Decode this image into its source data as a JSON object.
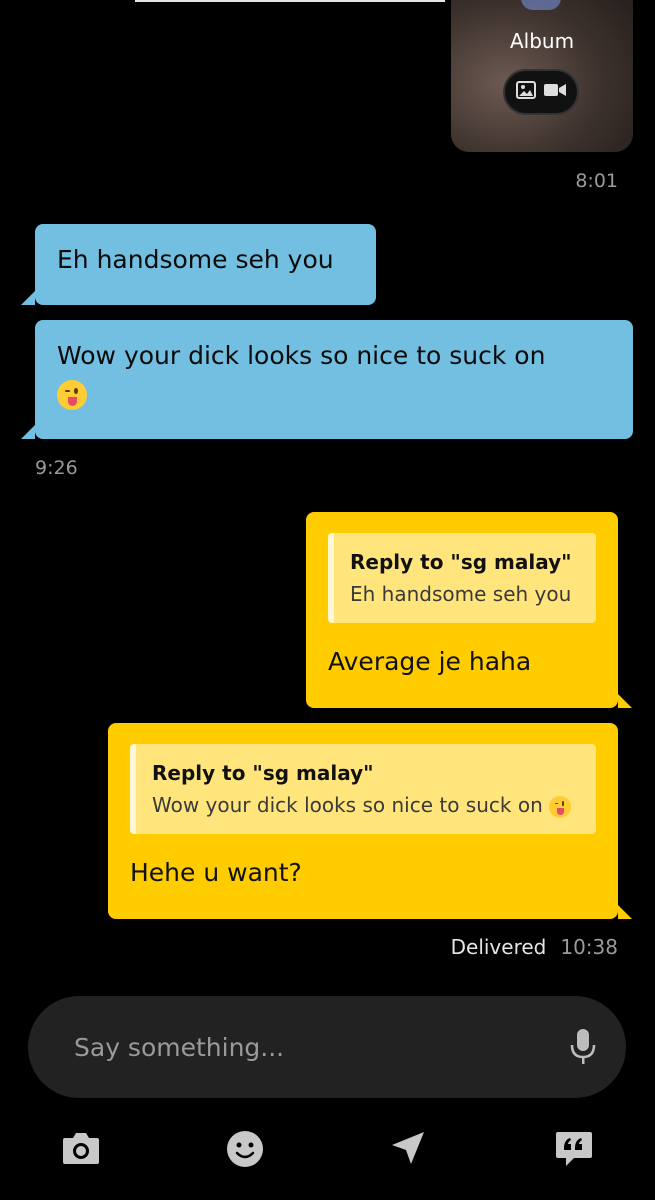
{
  "album": {
    "label": "Album",
    "time": "8:01"
  },
  "incoming": [
    {
      "text": "Eh handsome seh you"
    },
    {
      "text": "Wow your dick looks so nice to suck on"
    }
  ],
  "incoming_time": "9:26",
  "outgoing": [
    {
      "quote_title": "Reply to \"sg malay\"",
      "quote_text": "Eh handsome seh you",
      "text": "Average je haha"
    },
    {
      "quote_title": "Reply to \"sg malay\"",
      "quote_text": "Wow your dick looks so nice to suck on",
      "text": "Hehe u want?"
    }
  ],
  "status": {
    "delivered": "Delivered",
    "time": "10:38"
  },
  "composer": {
    "placeholder": "Say something..."
  },
  "toolbar": [
    "camera-icon",
    "emoji-icon",
    "location-icon",
    "quick-replies-icon"
  ],
  "colors": {
    "incoming_bubble": "#73bfe1",
    "outgoing_bubble": "#ffcc00",
    "quote_bg": "#ffe57c",
    "background": "#000000"
  }
}
